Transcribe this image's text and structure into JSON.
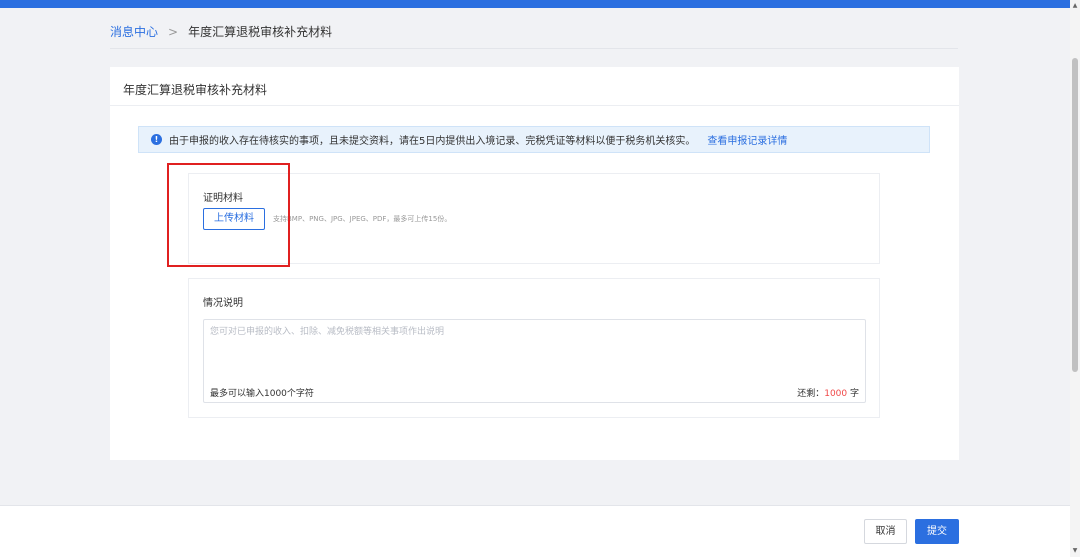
{
  "breadcrumb": {
    "parent": "消息中心",
    "separator": ">",
    "current": "年度汇算退税审核补充材料"
  },
  "card": {
    "title": "年度汇算退税审核补充材料"
  },
  "notice": {
    "icon": "info-icon",
    "icon_glyph": "!",
    "text": "由于申报的收入存在待核实的事项，且未提交资料，请在5日内提供出入境记录、完税凭证等材料以便于税务机关核实。",
    "link": "查看申报记录详情"
  },
  "upload": {
    "label": "证明材料",
    "button_label": "上传材料",
    "hint": "支持BMP、PNG、JPG、JPEG、PDF，最多可上传15份。"
  },
  "description": {
    "label": "情况说明",
    "placeholder": "您可对已申报的收入、扣除、减免税额等相关事项作出说明",
    "value": "",
    "limit_text": "最多可以输入1000个字符",
    "remaining_prefix": "还剩：",
    "remaining_count": "1000",
    "remaining_suffix": " 字"
  },
  "footer": {
    "cancel_label": "取消",
    "submit_label": "提交"
  },
  "scrollbar": {
    "up_glyph": "▲",
    "down_glyph": "▼"
  },
  "colors": {
    "accent": "#2b6fe0",
    "highlight": "#e02020",
    "counter": "#f04848",
    "notice_bg": "#e8f2fc"
  }
}
